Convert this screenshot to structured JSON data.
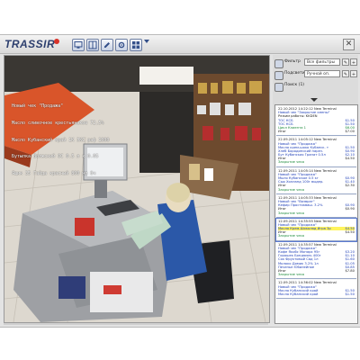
{
  "app": {
    "logo_text": "TRASSIR",
    "accent_color": "#e23b2b",
    "toolbar_icons": [
      "monitor-icon",
      "split-view-icon",
      "edit-icon",
      "settings-icon",
      "grid-icon"
    ]
  },
  "video": {
    "osd_lines": [
      "Новый чек \"Продажа\"",
      "Масло сливочное крестьянское 72,5%",
      "Масло Кубанский край 1К ЭКС раф 1000",
      "Бутылка Волжский ОС 0.5 л х 0.05",
      "Ящик 35 Гайда красный 800 мл бч"
    ]
  },
  "controls": {
    "filter_label": "Фильтр",
    "filter_value": "Все фильтры",
    "highlight_label": "Подсветить",
    "highlight_value": "Ручной оп.",
    "search_label": "Поиск (1)"
  },
  "receipts": [
    {
      "lines": [
        {
          "text": "22.10.2012 14:22:12 New Terminal",
          "value": "",
          "color": "black"
        },
        {
          "text": "Новый чек \"Закрытие смены\"",
          "value": "",
          "color": "blue"
        },
        {
          "text": "Режим работы: KKDEN",
          "value": "",
          "color": "black"
        },
        {
          "text": "ТОС КСБ",
          "value": "$1.50",
          "color": "blue"
        },
        {
          "text": "ТОС КСБ",
          "value": "$1.50",
          "color": "blue"
        },
        {
          "text": "Цикл Клиента 1",
          "value": "$6.00",
          "color": "green"
        },
        {
          "text": "Итог",
          "value": "$7.00",
          "color": "black"
        }
      ],
      "selected": false
    },
    {
      "lines": [
        {
          "text": "22.09.2011 14:05:12 New Terminal",
          "value": "",
          "color": "black"
        },
        {
          "text": "Новый чек \"Продажа\"",
          "value": "",
          "color": "blue"
        },
        {
          "text": "Масло крем-шоко Кубанск. т",
          "value": "$1.50",
          "color": "blue"
        },
        {
          "text": "Хлеб Бородинский нарез.",
          "value": "$0.90",
          "color": "blue"
        },
        {
          "text": "Бут Кубанская Гранат 0.5л",
          "value": "$2.10",
          "color": "blue"
        },
        {
          "text": "Итог",
          "value": "$4.50",
          "color": "black"
        },
        {
          "text": "Закрытие чека",
          "value": "",
          "color": "green"
        }
      ],
      "selected": false
    },
    {
      "lines": [
        {
          "text": "12.09.2011 14:05:14 New Terminal",
          "value": "",
          "color": "black"
        },
        {
          "text": "Новый чек \"Продажа\"",
          "value": "",
          "color": "blue"
        },
        {
          "text": "Мыло Кубанское 0.5 кг",
          "value": "$0.90",
          "color": "blue"
        },
        {
          "text": "Сыр Холланд 100г выдер.",
          "value": "$1.40",
          "color": "blue"
        },
        {
          "text": "Итог",
          "value": "$2.30",
          "color": "black"
        },
        {
          "text": "Закрытие чека",
          "value": "",
          "color": "green"
        }
      ],
      "selected": false
    },
    {
      "lines": [
        {
          "text": "12.09.2011 14:05:33 New Terminal",
          "value": "",
          "color": "black"
        },
        {
          "text": "Новый чек \"Возврат\"",
          "value": "",
          "color": "blue"
        },
        {
          "text": "Кефир Простокваш. 3.2%",
          "value": "$0.90",
          "color": "blue"
        },
        {
          "text": "Итог",
          "value": "$0.90",
          "color": "black"
        },
        {
          "text": "Закрытие чека",
          "value": "",
          "color": "green"
        }
      ],
      "selected": false
    },
    {
      "lines": [
        {
          "text": "12.09.2011 14:35:55 New Terminal",
          "value": "",
          "color": "black"
        },
        {
          "text": "Новый чек \"Продажа\"",
          "value": "",
          "color": "blue"
        },
        {
          "text": "Масло Крем-Шоколад Игра 3р",
          "value": "$4.50",
          "color": "blue",
          "highlight": true
        },
        {
          "text": "Итог",
          "value": "$4.50",
          "color": "black"
        },
        {
          "text": "Закрытие чека",
          "value": "",
          "color": "green"
        }
      ],
      "selected": true
    },
    {
      "lines": [
        {
          "text": "12.09.2011 14:35:57 New Terminal",
          "value": "",
          "color": "black"
        },
        {
          "text": "Новый чек \"Продажа\"",
          "value": "",
          "color": "blue"
        },
        {
          "text": "Кофе Якобс Монарх 95г",
          "value": "$3.20",
          "color": "blue"
        },
        {
          "text": "Горошек Бондюэль 400г",
          "value": "$1.10",
          "color": "blue"
        },
        {
          "text": "Сок Фруктовый Сад 1л",
          "value": "$1.60",
          "color": "blue"
        },
        {
          "text": "Молоко Домик 3.2% 1л",
          "value": "$1.05",
          "color": "blue"
        },
        {
          "text": "Печенье Юбилейное",
          "value": "$0.85",
          "color": "blue"
        },
        {
          "text": "Итог",
          "value": "$7.80",
          "color": "black"
        },
        {
          "text": "Закрытие чека",
          "value": "",
          "color": "green"
        }
      ],
      "selected": false
    },
    {
      "lines": [
        {
          "text": "12.09.2011 14:36:02 New Terminal",
          "value": "",
          "color": "black"
        },
        {
          "text": "Новый чек \"Продажа\"",
          "value": "",
          "color": "blue"
        },
        {
          "text": "Масло Кубанский край",
          "value": "$1.50",
          "color": "blue"
        },
        {
          "text": "Масло Кубанский край",
          "value": "$1.50",
          "color": "blue"
        }
      ],
      "selected": false
    }
  ]
}
